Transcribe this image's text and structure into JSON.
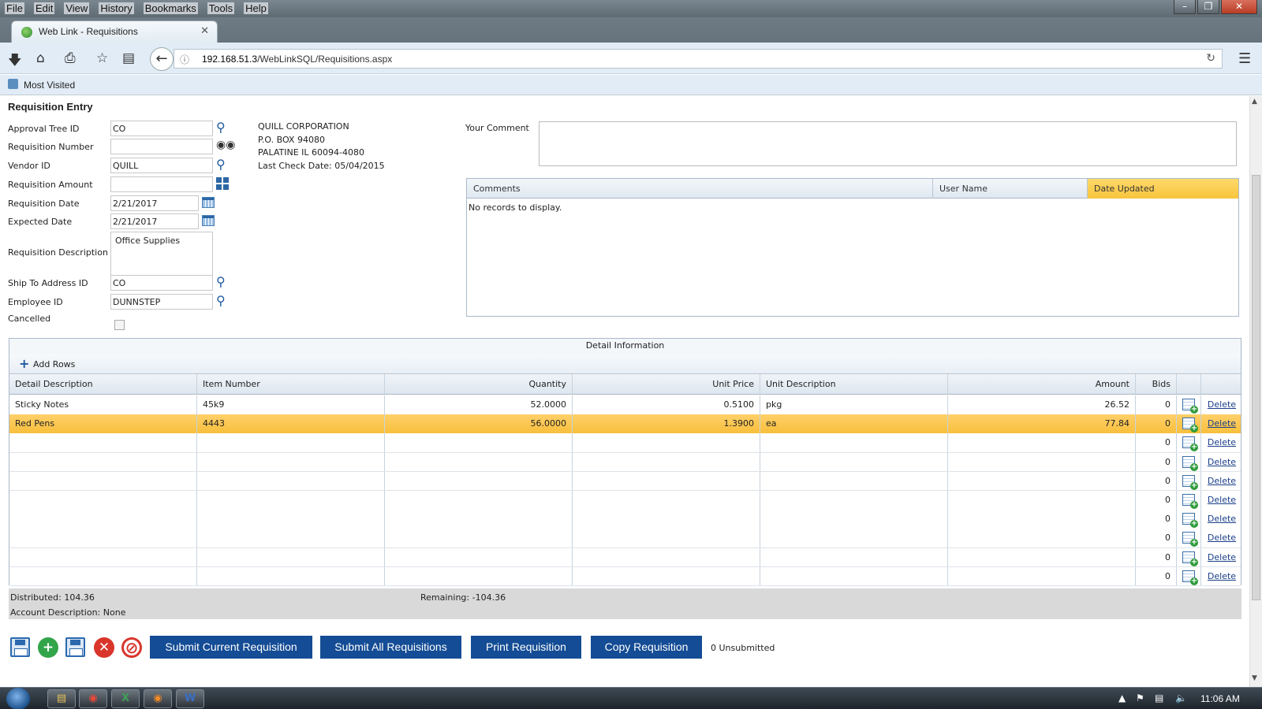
{
  "browser": {
    "menu": [
      "File",
      "Edit",
      "View",
      "History",
      "Bookmarks",
      "Tools",
      "Help"
    ],
    "tab_title": "Web Link - Requisitions",
    "url_host": "192.168.51.3",
    "url_path": "/WebLinkSQL/Requisitions.aspx",
    "bookmark": "Most Visited"
  },
  "form": {
    "heading": "Requisition Entry",
    "fields": {
      "approval_tree_id": {
        "label": "Approval Tree ID",
        "value": "CO"
      },
      "requisition_number": {
        "label": "Requisition Number",
        "value": ""
      },
      "vendor_id": {
        "label": "Vendor ID",
        "value": "QUILL"
      },
      "requisition_amount": {
        "label": "Requisition Amount",
        "value": ""
      },
      "requisition_date": {
        "label": "Requisition Date",
        "value": "2/21/2017"
      },
      "expected_date": {
        "label": "Expected Date",
        "value": "2/21/2017"
      },
      "requisition_description": {
        "label": "Requisition Description",
        "value": "Office Supplies"
      },
      "ship_to_address_id": {
        "label": "Ship To Address ID",
        "value": "CO"
      },
      "employee_id": {
        "label": "Employee ID",
        "value": "DUNNSTEP"
      },
      "cancelled": {
        "label": "Cancelled"
      }
    },
    "vendor_info": {
      "name": "QUILL CORPORATION",
      "address1": "P.O. BOX 94080",
      "address2": "PALATINE IL 60094-4080",
      "last_check": "Last Check Date: 05/04/2015"
    }
  },
  "comments": {
    "label": "Your Comment",
    "columns": [
      "Comments",
      "User Name",
      "Date Updated"
    ],
    "empty": "No records to display."
  },
  "detail": {
    "title": "Detail Information",
    "add_rows": "Add Rows",
    "columns": [
      "Detail Description",
      "Item Number",
      "Quantity",
      "Unit Price",
      "Unit Description",
      "Amount",
      "Bids"
    ],
    "delete_label": "Delete",
    "rows": [
      {
        "desc": "Sticky Notes",
        "item": "45k9",
        "qty": "52.0000",
        "price": "0.5100",
        "unit": "pkg",
        "amount": "26.52",
        "bids": "0"
      },
      {
        "desc": "Red Pens",
        "item": "4443",
        "qty": "56.0000",
        "price": "1.3900",
        "unit": "ea",
        "amount": "77.84",
        "bids": "0"
      },
      {
        "desc": "",
        "item": "",
        "qty": "",
        "price": "",
        "unit": "",
        "amount": "",
        "bids": "0"
      },
      {
        "desc": "",
        "item": "",
        "qty": "",
        "price": "",
        "unit": "",
        "amount": "",
        "bids": "0"
      },
      {
        "desc": "",
        "item": "",
        "qty": "",
        "price": "",
        "unit": "",
        "amount": "",
        "bids": "0"
      },
      {
        "desc": "",
        "item": "",
        "qty": "",
        "price": "",
        "unit": "",
        "amount": "",
        "bids": "0"
      },
      {
        "desc": "",
        "item": "",
        "qty": "",
        "price": "",
        "unit": "",
        "amount": "",
        "bids": "0"
      },
      {
        "desc": "",
        "item": "",
        "qty": "",
        "price": "",
        "unit": "",
        "amount": "",
        "bids": "0"
      },
      {
        "desc": "",
        "item": "",
        "qty": "",
        "price": "",
        "unit": "",
        "amount": "",
        "bids": "0"
      },
      {
        "desc": "",
        "item": "",
        "qty": "",
        "price": "",
        "unit": "",
        "amount": "",
        "bids": "0"
      }
    ]
  },
  "summary": {
    "distributed": "Distributed: 104.36",
    "remaining": "Remaining: -104.36",
    "account": "Account Description: None"
  },
  "actions": {
    "submit_current": "Submit Current Requisition",
    "submit_all": "Submit All Requisitions",
    "print": "Print Requisition",
    "copy": "Copy Requisition",
    "unsubmitted": "0 Unsubmitted"
  },
  "taskbar": {
    "clock": "11:06 AM",
    "excel_letter": "X",
    "word_letter": "W"
  },
  "colors": {
    "button_blue": "#144c95",
    "selected_row": "#f8bf3c",
    "link_blue": "#1a3f88"
  },
  "icons": [
    "search-icon",
    "binoculars-icon",
    "calendar-icon",
    "calculator-icon",
    "save-icon",
    "add-icon",
    "save-new-icon",
    "delete-icon",
    "cancel-icon",
    "add-bid-icon"
  ]
}
